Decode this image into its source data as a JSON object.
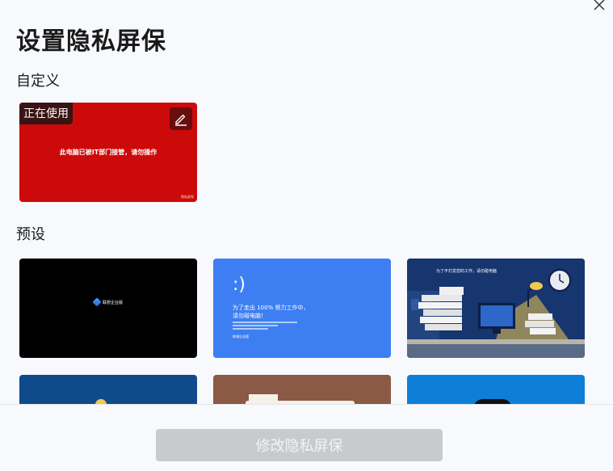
{
  "dialog": {
    "title": "设置隐私屏保",
    "close_icon": "close-icon"
  },
  "sections": {
    "custom_label": "自定义",
    "preset_label": "预设"
  },
  "custom_card": {
    "in_use_label": "正在使用",
    "message": "此电脑已被IT部门接管，请勿操作",
    "footer_text": "隐私屏保",
    "edit_icon": "pencil-icon",
    "background_color": "#cc0a0a"
  },
  "presets": [
    {
      "id": "black",
      "logo_text": "联想企业版",
      "background_color": "#000000"
    },
    {
      "id": "blue-screen",
      "face": ":)",
      "text": "为了走出 100% 努力工作中，\n请勿碰电脑！",
      "logo_text": "联想企业版",
      "background_color": "#3d7ff2"
    },
    {
      "id": "desk-illustration",
      "headline": "为了不打扰您的工作，请勿碰电脑",
      "background_color": "#17356e"
    },
    {
      "id": "preset-4",
      "background_color": "#0f4a8a"
    },
    {
      "id": "preset-5",
      "background_color": "#8a5a44"
    },
    {
      "id": "preset-6",
      "background_color": "#0d7fd8"
    }
  ],
  "footer": {
    "primary_button_label": "修改隐私屏保"
  }
}
